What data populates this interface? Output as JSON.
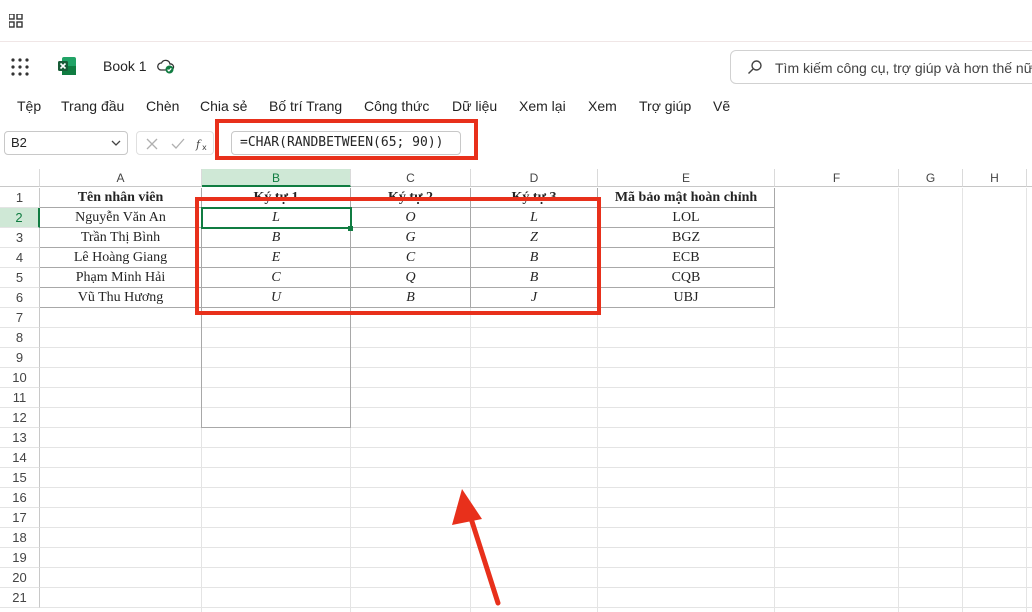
{
  "app": {
    "doc_title": "Book 1",
    "search_placeholder": "Tìm kiếm công cụ, trợ giúp và hơn thế nữa",
    "accent": "#107c41"
  },
  "menu": [
    "Tệp",
    "Trang đầu",
    "Chèn",
    "Chia sẻ",
    "Bố trí Trang",
    "Công thức",
    "Dữ liệu",
    "Xem lại",
    "Xem",
    "Trợ giúp",
    "Vẽ"
  ],
  "formula_bar": {
    "name_box": "B2",
    "formula": "=CHAR(RANDBETWEEN(65; 90))"
  },
  "sheet": {
    "columns": [
      "A",
      "B",
      "C",
      "D",
      "E",
      "F",
      "G",
      "H"
    ],
    "rows": [
      "1",
      "2",
      "3",
      "4",
      "5",
      "6",
      "7",
      "8",
      "9",
      "10",
      "11",
      "12",
      "13",
      "14",
      "15",
      "16",
      "17",
      "18",
      "19",
      "20",
      "21"
    ],
    "header_row": [
      "Tên nhân viên",
      "Ký tự 1",
      "Ký tự 2",
      "Ký tự 3",
      "Mã bảo mật hoàn chỉnh"
    ],
    "data": [
      [
        "Nguyễn Văn An",
        "L",
        "O",
        "L",
        "LOL"
      ],
      [
        "Trần Thị Bình",
        "B",
        "G",
        "Z",
        "BGZ"
      ],
      [
        "Lê Hoàng Giang",
        "E",
        "C",
        "B",
        "ECB"
      ],
      [
        "Phạm Minh Hải",
        "C",
        "Q",
        "B",
        "CQB"
      ],
      [
        "Vũ Thu Hương",
        "U",
        "B",
        "J",
        "UBJ"
      ]
    ],
    "active_cell": "B2"
  }
}
